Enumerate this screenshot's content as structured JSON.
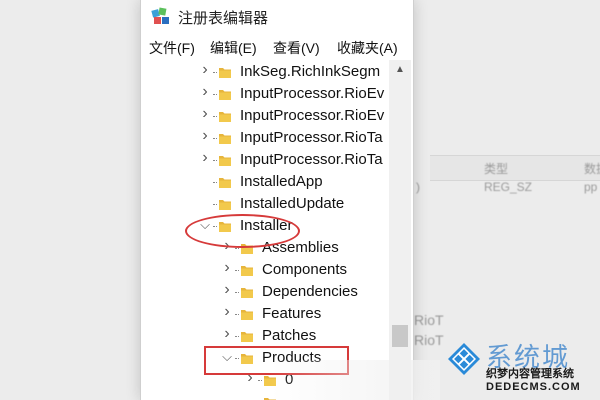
{
  "window": {
    "title": "注册表编辑器",
    "icon": "regedit-icon"
  },
  "menu": [
    {
      "label": "文件(F)"
    },
    {
      "label": "编辑(E)"
    },
    {
      "label": "查看(V)"
    },
    {
      "label": "收藏夹(A)"
    }
  ],
  "tree": [
    {
      "label": "InkSeg.RichInkSegm",
      "depth": 1,
      "expander": "collapsed"
    },
    {
      "label": "InputProcessor.RioEv",
      "depth": 1,
      "expander": "collapsed"
    },
    {
      "label": "InputProcessor.RioEv",
      "depth": 1,
      "expander": "collapsed"
    },
    {
      "label": "InputProcessor.RioTa",
      "depth": 1,
      "expander": "collapsed"
    },
    {
      "label": "InputProcessor.RioTa",
      "depth": 1,
      "expander": "collapsed"
    },
    {
      "label": "InstalledApp",
      "depth": 1,
      "expander": "none"
    },
    {
      "label": "InstalledUpdate",
      "depth": 1,
      "expander": "none"
    },
    {
      "label": "Installer",
      "depth": 1,
      "expander": "expanded",
      "highlight": "ellipse"
    },
    {
      "label": "Assemblies",
      "depth": 2,
      "expander": "collapsed"
    },
    {
      "label": "Components",
      "depth": 2,
      "expander": "collapsed"
    },
    {
      "label": "Dependencies",
      "depth": 2,
      "expander": "collapsed"
    },
    {
      "label": "Features",
      "depth": 2,
      "expander": "collapsed"
    },
    {
      "label": "Patches",
      "depth": 2,
      "expander": "collapsed"
    },
    {
      "label": "Products",
      "depth": 2,
      "expander": "expanded",
      "highlight": "rect"
    },
    {
      "label": "0",
      "depth": 3,
      "expander": "collapsed"
    },
    {
      "label": "",
      "depth": 3,
      "expander": "none"
    }
  ],
  "background": {
    "col_type": "类型",
    "col_data": "数据",
    "type_value": "REG_SZ",
    "data_value": "pp",
    "paren": ")",
    "riot1": "RioT",
    "riot2": "RioT"
  },
  "watermark": {
    "big": "系统城",
    "line1": "织梦内容管理系统",
    "line2": "DEDECMS.COM"
  },
  "colors": {
    "annotation": "#d63a3a",
    "folder": "#f2c94c",
    "watermark_blue": "#2878c8"
  }
}
